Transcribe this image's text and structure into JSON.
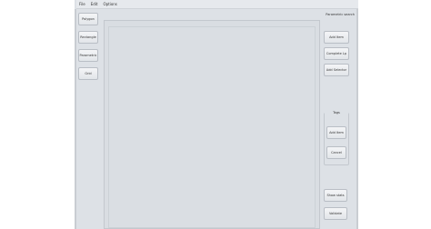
{
  "menubar": {
    "items": [
      "File",
      "Edit",
      "Options"
    ]
  },
  "left_panel": {
    "buttons": [
      "Polygon",
      "Rectangle",
      "Parametric",
      "Grid"
    ]
  },
  "right_panel": {
    "header": "Parametric search",
    "buttons": [
      "Add Item",
      "Complete Lp",
      "Add Selector"
    ],
    "group": {
      "title": "Tags",
      "buttons": [
        "Add Item",
        "Cancel"
      ]
    },
    "bottom_buttons": [
      "Show stats",
      "Validate"
    ]
  }
}
